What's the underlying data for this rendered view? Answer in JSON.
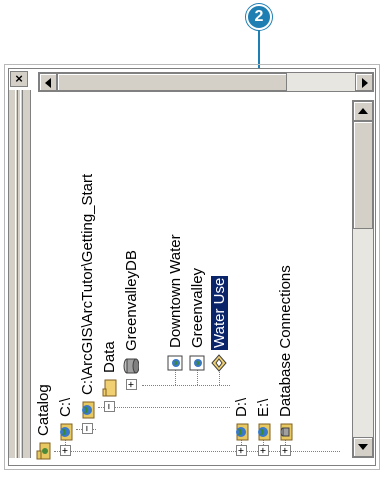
{
  "callout": {
    "number": "2"
  },
  "window": {
    "close_glyph": "×"
  },
  "scrollbars": {
    "left_arrow": "left-arrow-icon",
    "right_arrow": "right-arrow-icon",
    "up_arrow": "up-arrow-icon",
    "down_arrow": "down-arrow-icon"
  },
  "tree": {
    "root": "Catalog",
    "drive_c": "C:\\",
    "getting_started": "C:\\ArcGIS\\ArcTutor\\Getting_Start",
    "data": "Data",
    "greenvalley_db": "GreenvalleyDB",
    "downtown_water": "Downtown Water",
    "greenvalley": "Greenvalley",
    "water_use": "Water Use",
    "drive_d": "D:\\",
    "drive_e": "E:\\",
    "db_connections": "Database Connections",
    "expand_glyph": "+",
    "collapse_glyph": "−"
  },
  "colors": {
    "selection": "#0a246a",
    "callout": "#1f7fb3",
    "chrome": "#d4d0c8"
  }
}
